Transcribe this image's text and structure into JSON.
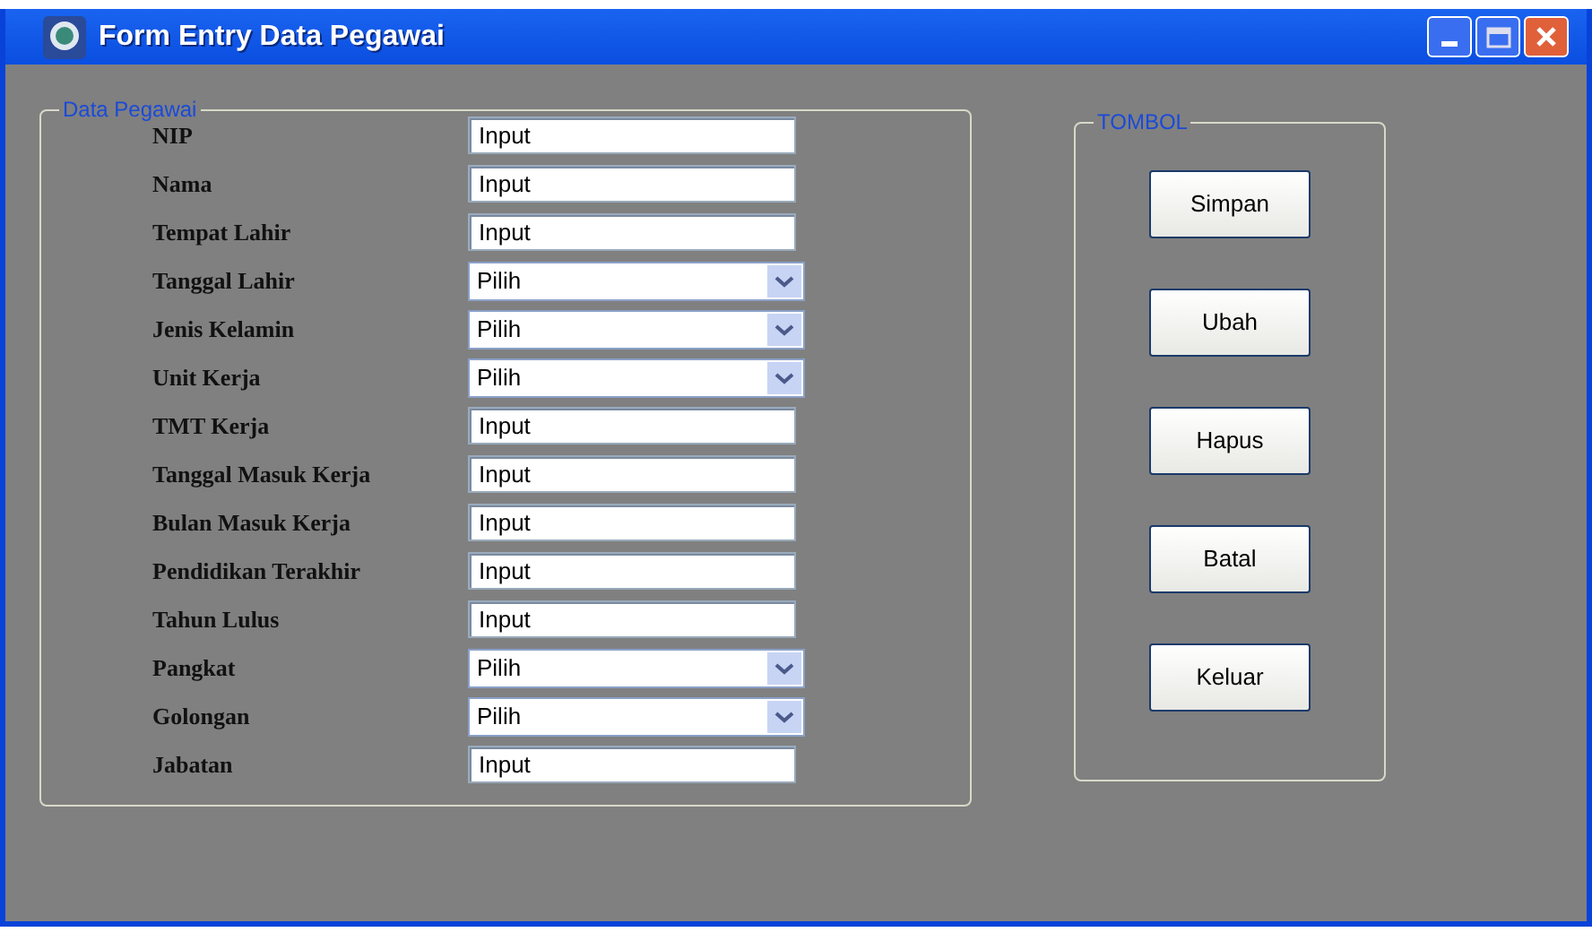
{
  "window": {
    "title": "Form Entry Data Pegawai"
  },
  "data_pegawai": {
    "legend": "Data Pegawai",
    "fields": [
      {
        "label": "NIP",
        "kind": "text",
        "value": "Input"
      },
      {
        "label": "Nama",
        "kind": "text",
        "value": "Input"
      },
      {
        "label": "Tempat Lahir",
        "kind": "text",
        "value": "Input"
      },
      {
        "label": "Tanggal Lahir",
        "kind": "select",
        "value": "Pilih"
      },
      {
        "label": "Jenis Kelamin",
        "kind": "select",
        "value": "Pilih"
      },
      {
        "label": "Unit Kerja",
        "kind": "select",
        "value": "Pilih"
      },
      {
        "label": "TMT Kerja",
        "kind": "text",
        "value": "Input"
      },
      {
        "label": "Tanggal Masuk Kerja",
        "kind": "text",
        "value": "Input"
      },
      {
        "label": "Bulan Masuk Kerja",
        "kind": "text",
        "value": "Input"
      },
      {
        "label": "Pendidikan Terakhir",
        "kind": "text",
        "value": "Input"
      },
      {
        "label": "Tahun Lulus",
        "kind": "text",
        "value": "Input"
      },
      {
        "label": "Pangkat",
        "kind": "select",
        "value": "Pilih"
      },
      {
        "label": "Golongan",
        "kind": "select",
        "value": "Pilih"
      },
      {
        "label": "Jabatan",
        "kind": "text",
        "value": "Input"
      }
    ]
  },
  "tombol": {
    "legend": "TOMBOL",
    "buttons": [
      "Simpan",
      "Ubah",
      "Hapus",
      "Batal",
      "Keluar"
    ]
  }
}
